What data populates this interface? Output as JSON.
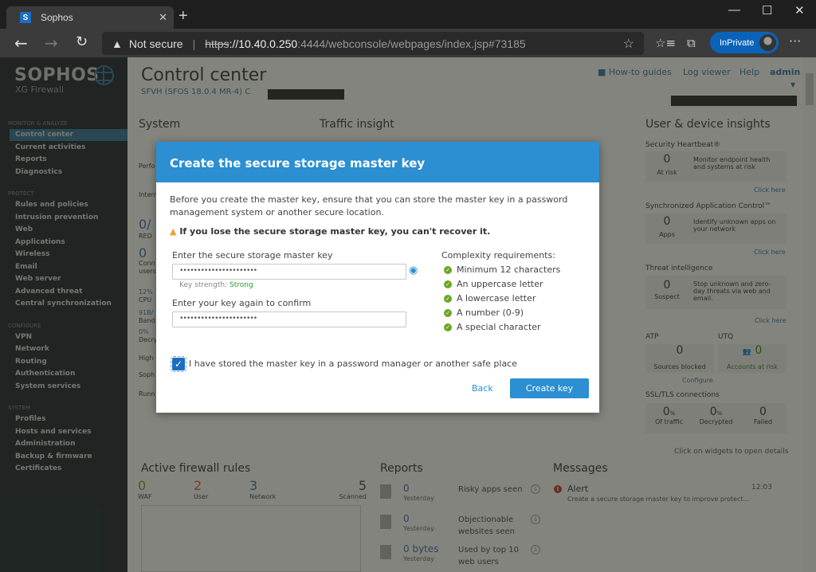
{
  "browser": {
    "tab_title": "Sophos",
    "tab_favicon": "S",
    "security_label": "Not secure",
    "url_scheme": "https",
    "url_host": "://10.40.0.250",
    "url_path": ":4444/webconsole/webpages/index.jsp#73185",
    "inprivate_label": "InPrivate"
  },
  "brand": {
    "name": "SOPHOS",
    "product": "XG Firewall"
  },
  "sidebar": {
    "sections": [
      {
        "label": "MONITOR & ANALYZE",
        "items": [
          "Control center",
          "Current activities",
          "Reports",
          "Diagnostics"
        ]
      },
      {
        "label": "PROTECT",
        "items": [
          "Rules and policies",
          "Intrusion prevention",
          "Web",
          "Applications",
          "Wireless",
          "Email",
          "Web server",
          "Advanced threat",
          "Central synchronization"
        ]
      },
      {
        "label": "CONFIGURE",
        "items": [
          "VPN",
          "Network",
          "Routing",
          "Authentication",
          "System services"
        ]
      },
      {
        "label": "SYSTEM",
        "items": [
          "Profiles",
          "Hosts and services",
          "Administration",
          "Backup & firmware",
          "Certificates"
        ]
      }
    ],
    "active_item": "Control center"
  },
  "header": {
    "title": "Control center",
    "subtitle": "SFVH (SFOS 18.0.4 MR-4) C",
    "links": {
      "howto": "How-to guides",
      "logviewer": "Log viewer",
      "help": "Help",
      "user": "admin"
    }
  },
  "system": {
    "title": "System",
    "labels": [
      "Perfo",
      "Intern"
    ],
    "red": {
      "value": "0/",
      "label": "RED"
    },
    "connected": {
      "value": "0",
      "label1": "Conn",
      "label2": "users"
    },
    "cpu": {
      "value": "12%",
      "label": "CPU"
    },
    "bandwidth": {
      "value": "91B/",
      "label": "Band"
    },
    "decrypt": {
      "value": "0%",
      "label": "Decry"
    },
    "rows": [
      "High",
      "Soph",
      "Runn"
    ]
  },
  "traffic": {
    "title": "Traffic insight"
  },
  "insights": {
    "title": "User & device insights",
    "heartbeat": {
      "title": "Security Heartbeat®",
      "value": "0",
      "label": "At risk",
      "desc": "Monitor endpoint health and systems at risk",
      "link": "Click here"
    },
    "sac": {
      "title": "Synchronized Application Control™",
      "value": "0",
      "label": "Apps",
      "desc": "Identify unknown apps on your network",
      "link": "Click here"
    },
    "threat": {
      "title": "Threat intelligence",
      "value": "0",
      "label": "Suspect",
      "desc": "Stop unknown and zero-day threats via web and email.",
      "link": "Click here"
    },
    "atp": {
      "title": "ATP",
      "value": "0",
      "label": "Sources blocked",
      "link": "Configure"
    },
    "utq": {
      "title": "UTQ",
      "value": "0",
      "label": "Accounts at risk"
    },
    "ssl": {
      "title": "SSL/TLS connections",
      "items": [
        {
          "value": "0",
          "unit": "%",
          "label": "Of traffic"
        },
        {
          "value": "0",
          "unit": "%",
          "label": "Decrypted"
        },
        {
          "value": "0",
          "unit": "",
          "label": "Failed"
        }
      ]
    },
    "hint": "Click on widgets to open details"
  },
  "firewall": {
    "title": "Active firewall rules",
    "stats": [
      {
        "value": "0",
        "label": "WAF",
        "color": "#6a9a1f"
      },
      {
        "value": "2",
        "label": "User",
        "color": "#d9541e"
      },
      {
        "value": "3",
        "label": "Network",
        "color": "#2d6ea4"
      },
      {
        "value": "5",
        "label": "Scanned",
        "color": "#444444"
      }
    ]
  },
  "reports": {
    "title": "Reports",
    "items": [
      {
        "value": "0",
        "period": "Yesterday",
        "desc": "Risky apps seen"
      },
      {
        "value": "0",
        "period": "Yesterday",
        "desc": "Objectionable websites seen"
      },
      {
        "value": "0 bytes",
        "period": "Yesterday",
        "desc": "Used by top 10 web users"
      }
    ]
  },
  "messages": {
    "title": "Messages",
    "items": [
      {
        "title": "Alert",
        "time": "12:03",
        "text": "Create a secure storage master key to improve protect..."
      }
    ]
  },
  "dialog": {
    "title": "Create the secure storage master key",
    "intro": "Before you create the master key, ensure that you can store the master key in a password management system or another secure location.",
    "warning": "If you lose the secure storage master key, you can't recover it.",
    "key_label": "Enter the secure storage master key",
    "key_value": "••••••••••••••••••••••",
    "strength_label": "Key strength:",
    "strength_value": "Strong",
    "confirm_label": "Enter your key again to confirm",
    "confirm_value": "••••••••••••••••••••••",
    "requirements_title": "Complexity requirements:",
    "requirements": [
      "Minimum 12 characters",
      "An uppercase letter",
      "A lowercase letter",
      "A number (0-9)",
      "A special character"
    ],
    "checkbox_label": "I have stored the master key in a password manager or another safe place",
    "checkbox_checked": true,
    "back_label": "Back",
    "create_label": "Create key"
  }
}
